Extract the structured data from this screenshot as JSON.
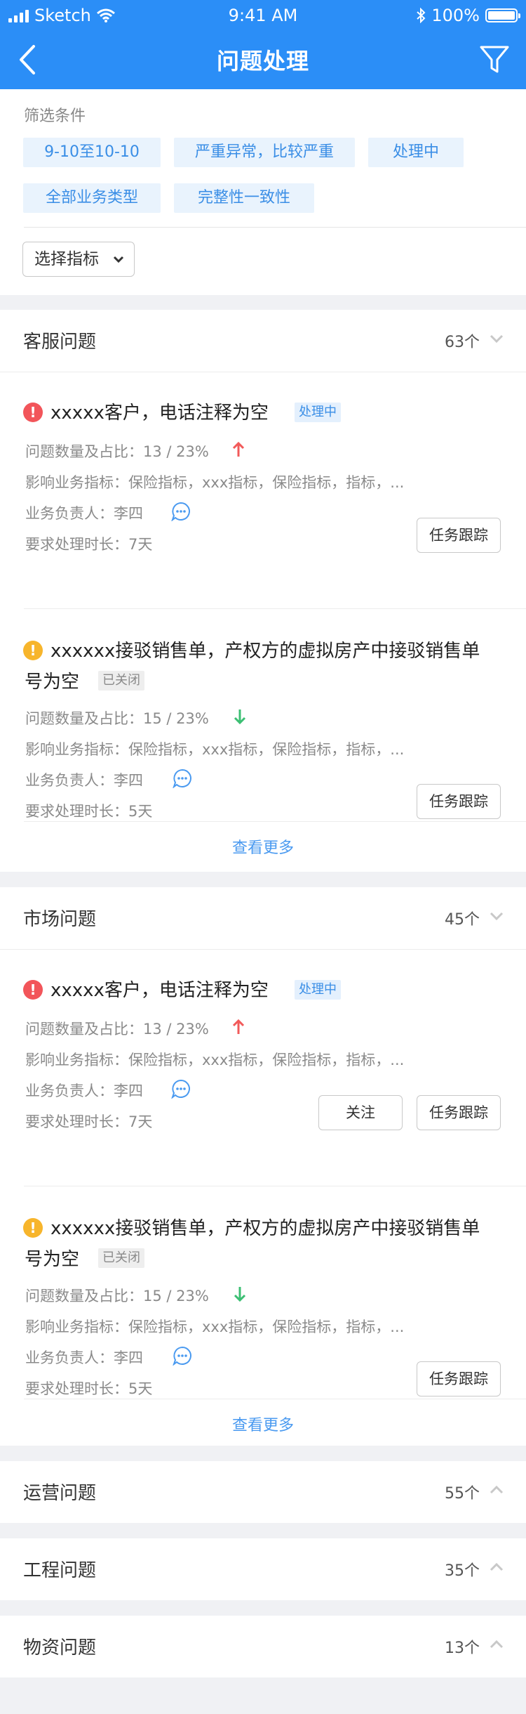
{
  "status_bar": {
    "carrier": "Sketch",
    "time": "9:41 AM",
    "battery": "100%"
  },
  "nav": {
    "title": "问题处理"
  },
  "filters": {
    "label": "筛选条件",
    "tags": [
      "9-10至10-10",
      "严重异常，比较严重",
      "处理中",
      "全部业务类型",
      "完整性一致性"
    ],
    "select_label": "选择指标"
  },
  "labels": {
    "ratio": "问题数量及占比：",
    "metrics": "影响业务指标：",
    "owner": "业务负责人：",
    "duration": "要求处理时长：",
    "track_btn": "任务跟踪",
    "follow_btn": "关注",
    "more": "查看更多"
  },
  "sections": [
    {
      "name": "客服问题",
      "count": "63个",
      "expanded": true,
      "cards": [
        {
          "severity": "red",
          "title": "xxxxx客户，电话注释为空",
          "title_line2": "",
          "status": "处理中",
          "ratio": "13 / 23%",
          "trend": "up",
          "metrics": "保险指标，xxx指标，保险指标，指标，...",
          "owner": "李四",
          "duration": "7天",
          "buttons": [
            "任务跟踪"
          ]
        },
        {
          "severity": "yellow",
          "title": "xxxxxx接驳销售单，产权方的虚拟房产中接驳销售单",
          "title_line2": "号为空",
          "status": "已关闭",
          "ratio": "15 / 23%",
          "trend": "down",
          "metrics": "保险指标，xxx指标，保险指标，指标，...",
          "owner": "李四",
          "duration": "5天",
          "buttons": [
            "任务跟踪"
          ]
        }
      ]
    },
    {
      "name": "市场问题",
      "count": "45个",
      "expanded": true,
      "cards": [
        {
          "severity": "red",
          "title": "xxxxx客户，电话注释为空",
          "title_line2": "",
          "status": "处理中",
          "ratio": "13 / 23%",
          "trend": "up",
          "metrics": "保险指标，xxx指标，保险指标，指标，...",
          "owner": "李四",
          "duration": "7天",
          "buttons": [
            "关注",
            "任务跟踪"
          ]
        },
        {
          "severity": "yellow",
          "title": "xxxxxx接驳销售单，产权方的虚拟房产中接驳销售单",
          "title_line2": "号为空",
          "status": "已关闭",
          "ratio": "15 / 23%",
          "trend": "down",
          "metrics": "保险指标，xxx指标，保险指标，指标，...",
          "owner": "李四",
          "duration": "5天",
          "buttons": [
            "任务跟踪"
          ]
        }
      ]
    },
    {
      "name": "运营问题",
      "count": "55个",
      "expanded": false
    },
    {
      "name": "工程问题",
      "count": "35个",
      "expanded": false
    },
    {
      "name": "物资问题",
      "count": "13个",
      "expanded": false
    }
  ],
  "colors": {
    "primary": "#2b8ef7",
    "danger": "#f2555a",
    "warning": "#f7b52c",
    "up": "#f25a5a",
    "down": "#3cbf73",
    "link": "#4a9af0"
  },
  "icons": [
    "back-icon",
    "filter-icon",
    "caret-down-icon",
    "chevron-down-icon",
    "chevron-up-icon",
    "alert-icon",
    "arrow-up-icon",
    "arrow-down-icon",
    "chat-icon",
    "wifi-icon",
    "bluetooth-icon",
    "battery-icon"
  ]
}
